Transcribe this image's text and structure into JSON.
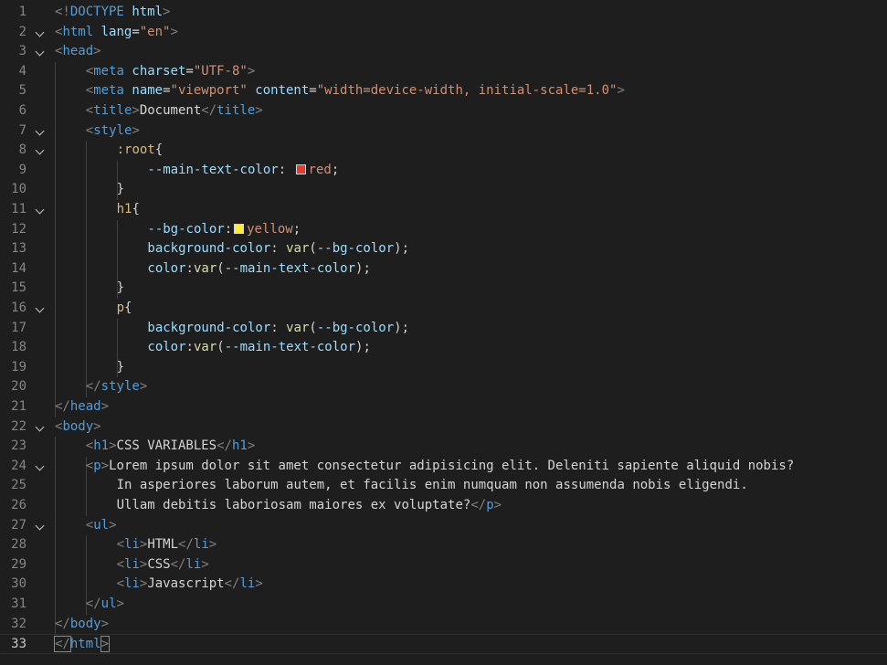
{
  "editor": {
    "language": "html",
    "current_line": 33,
    "swatch_colors": {
      "red": "#e53935",
      "yellow": "#ffeb3b"
    },
    "lines": [
      {
        "n": "1",
        "fold": false,
        "indent": 0,
        "tokens": [
          [
            "punct",
            "<!"
          ],
          [
            "tag",
            "DOCTYPE"
          ],
          [
            "txt",
            " "
          ],
          [
            "attr",
            "html"
          ],
          [
            "punct",
            ">"
          ]
        ]
      },
      {
        "n": "2",
        "fold": true,
        "indent": 0,
        "tokens": [
          [
            "punct",
            "<"
          ],
          [
            "tag",
            "html"
          ],
          [
            "txt",
            " "
          ],
          [
            "attr",
            "lang"
          ],
          [
            "txt",
            "="
          ],
          [
            "str",
            "\"en\""
          ],
          [
            "punct",
            ">"
          ]
        ]
      },
      {
        "n": "3",
        "fold": true,
        "indent": 0,
        "tokens": [
          [
            "punct",
            "<"
          ],
          [
            "tag",
            "head"
          ],
          [
            "punct",
            ">"
          ]
        ]
      },
      {
        "n": "4",
        "fold": false,
        "indent": 1,
        "tokens": [
          [
            "punct",
            "<"
          ],
          [
            "tag",
            "meta"
          ],
          [
            "txt",
            " "
          ],
          [
            "attr",
            "charset"
          ],
          [
            "txt",
            "="
          ],
          [
            "str",
            "\"UTF-8\""
          ],
          [
            "punct",
            ">"
          ]
        ]
      },
      {
        "n": "5",
        "fold": false,
        "indent": 1,
        "tokens": [
          [
            "punct",
            "<"
          ],
          [
            "tag",
            "meta"
          ],
          [
            "txt",
            " "
          ],
          [
            "attr",
            "name"
          ],
          [
            "txt",
            "="
          ],
          [
            "str",
            "\"viewport\""
          ],
          [
            "txt",
            " "
          ],
          [
            "attr",
            "content"
          ],
          [
            "txt",
            "="
          ],
          [
            "str",
            "\"width=device-width, initial-scale=1.0\""
          ],
          [
            "punct",
            ">"
          ]
        ]
      },
      {
        "n": "6",
        "fold": false,
        "indent": 1,
        "tokens": [
          [
            "punct",
            "<"
          ],
          [
            "tag",
            "title"
          ],
          [
            "punct",
            ">"
          ],
          [
            "txt",
            "Document"
          ],
          [
            "punct",
            "</"
          ],
          [
            "tag",
            "title"
          ],
          [
            "punct",
            ">"
          ]
        ]
      },
      {
        "n": "7",
        "fold": true,
        "indent": 1,
        "tokens": [
          [
            "punct",
            "<"
          ],
          [
            "tag",
            "style"
          ],
          [
            "punct",
            ">"
          ]
        ]
      },
      {
        "n": "8",
        "fold": true,
        "indent": 2,
        "tokens": [
          [
            "sel",
            ":root"
          ],
          [
            "txt",
            "{"
          ]
        ]
      },
      {
        "n": "9",
        "fold": false,
        "indent": 3,
        "tokens": [
          [
            "prop",
            "--main-text-color"
          ],
          [
            "txt",
            ": "
          ],
          [
            "swatch",
            "red"
          ],
          [
            "val",
            "red"
          ],
          [
            "txt",
            ";"
          ]
        ]
      },
      {
        "n": "10",
        "fold": false,
        "indent": 2,
        "tokens": [
          [
            "txt",
            "}"
          ]
        ]
      },
      {
        "n": "11",
        "fold": true,
        "indent": 2,
        "tokens": [
          [
            "sel",
            "h1"
          ],
          [
            "txt",
            "{"
          ]
        ]
      },
      {
        "n": "12",
        "fold": false,
        "indent": 3,
        "tokens": [
          [
            "prop",
            "--bg-color"
          ],
          [
            "txt",
            ":"
          ],
          [
            "swatch",
            "yellow"
          ],
          [
            "val",
            "yellow"
          ],
          [
            "txt",
            ";"
          ]
        ]
      },
      {
        "n": "13",
        "fold": false,
        "indent": 3,
        "tokens": [
          [
            "prop",
            "background-color"
          ],
          [
            "txt",
            ": "
          ],
          [
            "fn",
            "var"
          ],
          [
            "txt",
            "("
          ],
          [
            "prop",
            "--bg-color"
          ],
          [
            "txt",
            ");"
          ]
        ]
      },
      {
        "n": "14",
        "fold": false,
        "indent": 3,
        "tokens": [
          [
            "prop",
            "color"
          ],
          [
            "txt",
            ":"
          ],
          [
            "fn",
            "var"
          ],
          [
            "txt",
            "("
          ],
          [
            "prop",
            "--main-text-color"
          ],
          [
            "txt",
            ");"
          ]
        ]
      },
      {
        "n": "15",
        "fold": false,
        "indent": 2,
        "tokens": [
          [
            "txt",
            "}"
          ]
        ]
      },
      {
        "n": "16",
        "fold": true,
        "indent": 2,
        "tokens": [
          [
            "sel",
            "p"
          ],
          [
            "txt",
            "{"
          ]
        ]
      },
      {
        "n": "17",
        "fold": false,
        "indent": 3,
        "tokens": [
          [
            "prop",
            "background-color"
          ],
          [
            "txt",
            ": "
          ],
          [
            "fn",
            "var"
          ],
          [
            "txt",
            "("
          ],
          [
            "prop",
            "--bg-color"
          ],
          [
            "txt",
            ");"
          ]
        ]
      },
      {
        "n": "18",
        "fold": false,
        "indent": 3,
        "tokens": [
          [
            "prop",
            "color"
          ],
          [
            "txt",
            ":"
          ],
          [
            "fn",
            "var"
          ],
          [
            "txt",
            "("
          ],
          [
            "prop",
            "--main-text-color"
          ],
          [
            "txt",
            ");"
          ]
        ]
      },
      {
        "n": "19",
        "fold": false,
        "indent": 2,
        "tokens": [
          [
            "txt",
            "}"
          ]
        ]
      },
      {
        "n": "20",
        "fold": false,
        "indent": 1,
        "tokens": [
          [
            "punct",
            "</"
          ],
          [
            "tag",
            "style"
          ],
          [
            "punct",
            ">"
          ]
        ]
      },
      {
        "n": "21",
        "fold": false,
        "indent": 0,
        "tokens": [
          [
            "punct",
            "</"
          ],
          [
            "tag",
            "head"
          ],
          [
            "punct",
            ">"
          ]
        ]
      },
      {
        "n": "22",
        "fold": true,
        "indent": 0,
        "tokens": [
          [
            "punct",
            "<"
          ],
          [
            "tag",
            "body"
          ],
          [
            "punct",
            ">"
          ]
        ]
      },
      {
        "n": "23",
        "fold": false,
        "indent": 1,
        "tokens": [
          [
            "punct",
            "<"
          ],
          [
            "tag",
            "h1"
          ],
          [
            "punct",
            ">"
          ],
          [
            "txt",
            "CSS VARIABLES"
          ],
          [
            "punct",
            "</"
          ],
          [
            "tag",
            "h1"
          ],
          [
            "punct",
            ">"
          ]
        ]
      },
      {
        "n": "24",
        "fold": true,
        "indent": 1,
        "tokens": [
          [
            "punct",
            "<"
          ],
          [
            "tag",
            "p"
          ],
          [
            "punct",
            ">"
          ],
          [
            "txt",
            "Lorem ipsum dolor sit amet consectetur adipisicing elit. Deleniti sapiente aliquid nobis?"
          ]
        ]
      },
      {
        "n": "25",
        "fold": false,
        "indent": 2,
        "tokens": [
          [
            "txt",
            "In asperiores laborum autem, et facilis enim numquam non assumenda nobis eligendi."
          ]
        ]
      },
      {
        "n": "26",
        "fold": false,
        "indent": 2,
        "tokens": [
          [
            "txt",
            "Ullam debitis laboriosam maiores ex voluptate?"
          ],
          [
            "punct",
            "</"
          ],
          [
            "tag",
            "p"
          ],
          [
            "punct",
            ">"
          ]
        ]
      },
      {
        "n": "27",
        "fold": true,
        "indent": 1,
        "tokens": [
          [
            "punct",
            "<"
          ],
          [
            "tag",
            "ul"
          ],
          [
            "punct",
            ">"
          ]
        ]
      },
      {
        "n": "28",
        "fold": false,
        "indent": 2,
        "tokens": [
          [
            "punct",
            "<"
          ],
          [
            "tag",
            "li"
          ],
          [
            "punct",
            ">"
          ],
          [
            "txt",
            "HTML"
          ],
          [
            "punct",
            "</"
          ],
          [
            "tag",
            "li"
          ],
          [
            "punct",
            ">"
          ]
        ]
      },
      {
        "n": "29",
        "fold": false,
        "indent": 2,
        "tokens": [
          [
            "punct",
            "<"
          ],
          [
            "tag",
            "li"
          ],
          [
            "punct",
            ">"
          ],
          [
            "txt",
            "CSS"
          ],
          [
            "punct",
            "</"
          ],
          [
            "tag",
            "li"
          ],
          [
            "punct",
            ">"
          ]
        ]
      },
      {
        "n": "30",
        "fold": false,
        "indent": 2,
        "tokens": [
          [
            "punct",
            "<"
          ],
          [
            "tag",
            "li"
          ],
          [
            "punct",
            ">"
          ],
          [
            "txt",
            "Javascript"
          ],
          [
            "punct",
            "</"
          ],
          [
            "tag",
            "li"
          ],
          [
            "punct",
            ">"
          ]
        ]
      },
      {
        "n": "31",
        "fold": false,
        "indent": 1,
        "tokens": [
          [
            "punct",
            "</"
          ],
          [
            "tag",
            "ul"
          ],
          [
            "punct",
            ">"
          ]
        ]
      },
      {
        "n": "32",
        "fold": false,
        "indent": 0,
        "tokens": [
          [
            "punct",
            "</"
          ],
          [
            "tag",
            "body"
          ],
          [
            "punct",
            ">"
          ]
        ]
      },
      {
        "n": "33",
        "fold": false,
        "indent": 0,
        "tokens": [
          [
            "punct",
            "</"
          ],
          [
            "tag",
            "html"
          ],
          [
            "punct",
            ">"
          ]
        ]
      }
    ]
  }
}
